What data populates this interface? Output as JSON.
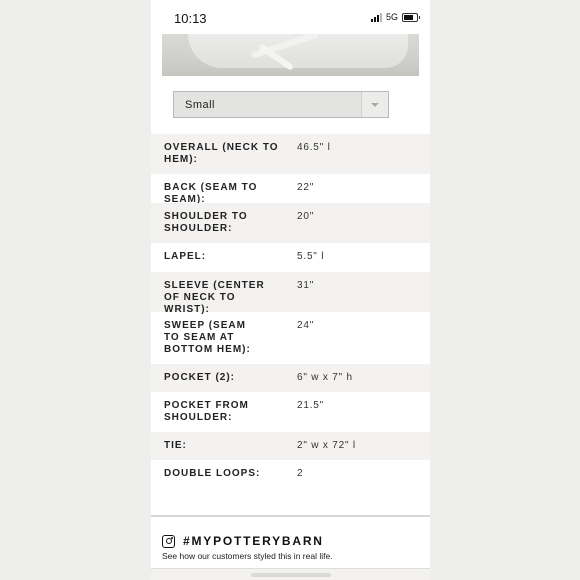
{
  "status": {
    "time": "10:13",
    "network": "5G",
    "battery_level": 0.75
  },
  "size_select": {
    "value": "Small"
  },
  "specs": [
    {
      "label": "OVERALL (NECK TO HEM):",
      "value": "46.5\" l"
    },
    {
      "label": "BACK (SEAM TO SEAM):",
      "value": "22\""
    },
    {
      "label": "SHOULDER TO SHOULDER:",
      "value": "20\""
    },
    {
      "label": "LAPEL:",
      "value": "5.5\" l"
    },
    {
      "label": "SLEEVE (CENTER OF NECK TO WRIST):",
      "value": "31\""
    },
    {
      "label": "SWEEP (SEAM TO SEAM AT BOTTOM HEM):",
      "value": "24\""
    },
    {
      "label": "POCKET (2):",
      "value": "6\" w x 7\" h"
    },
    {
      "label": "POCKET FROM SHOULDER:",
      "value": "21.5\""
    },
    {
      "label": "TIE:",
      "value": "2\" w x 72\" l"
    },
    {
      "label": "DOUBLE LOOPS:",
      "value": "2"
    }
  ],
  "instagram": {
    "title": "#MYPOTTERYBARN",
    "subtitle": "See how our customers styled this in real life."
  },
  "colors": {
    "row_shade": "#f3f2f0",
    "page_bg": "#eeeeec"
  }
}
